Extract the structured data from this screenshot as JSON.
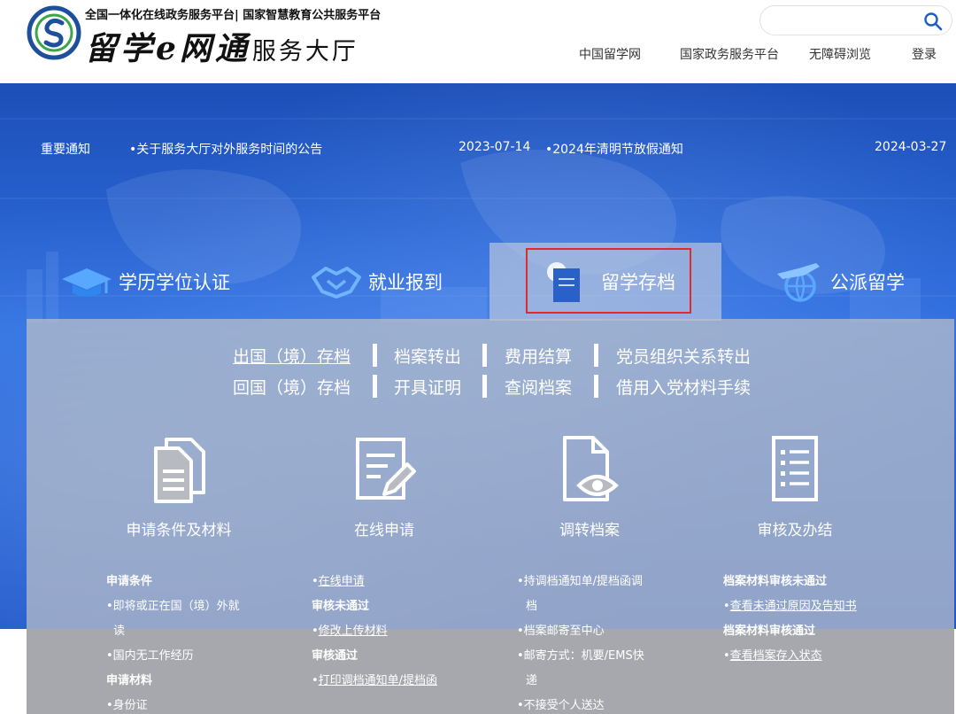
{
  "header": {
    "tagline": "全国一体化在线政务服务平台| 国家智慧教育公共服务平台",
    "title_brand": "留学e网通",
    "title_suffix": "服务大厅",
    "search_placeholder": "",
    "nav": [
      "中国留学网",
      "国家政务服务平台",
      "无障碍浏览",
      "登录"
    ]
  },
  "notices": {
    "label": "重要通知",
    "items": [
      {
        "text": "•关于服务大厅对外服务时间的公告",
        "date": "2023-07-14"
      },
      {
        "text": "•2024年清明节放假通知",
        "date": "2024-03-27"
      }
    ]
  },
  "categories": [
    {
      "label": "学历学位认证",
      "icon": "graduation-cap-icon",
      "active": false
    },
    {
      "label": "就业报到",
      "icon": "handshake-icon",
      "active": false
    },
    {
      "label": "留学存档",
      "icon": "archive-document-icon",
      "active": true
    },
    {
      "label": "公派留学",
      "icon": "plane-globe-icon",
      "active": false
    }
  ],
  "sub_links": {
    "row1": [
      "出国（境）存档",
      "档案转出",
      "费用结算",
      "党员组织关系转出"
    ],
    "row2": [
      "回国（境）存档",
      "开具证明",
      "查阅档案",
      "借用入党材料手续"
    ],
    "current": "出国（境）存档"
  },
  "steps": [
    {
      "label": "申请条件及材料",
      "icon": "documents-icon"
    },
    {
      "label": "在线申请",
      "icon": "form-edit-icon"
    },
    {
      "label": "调转档案",
      "icon": "file-view-icon"
    },
    {
      "label": "审核及办结",
      "icon": "checklist-icon"
    }
  ],
  "details": {
    "col1": {
      "h1": "申请条件",
      "i1a": "•即将或正在国（境）外就",
      "i1b": "读",
      "i2": "•国内无工作经历",
      "h2": "申请材料",
      "i3": "•身份证"
    },
    "col2": {
      "l1": "在线申请",
      "h1": "审核未通过",
      "l2": "修改上传材料",
      "h2": "审核通过",
      "l3": "打印调档通知单/提档函"
    },
    "col3": {
      "i1a": "•持调档通知单/提档函调",
      "i1b": "档",
      "i2": "•档案邮寄至中心",
      "i3a": "•邮寄方式：机要/EMS快",
      "i3b": "递",
      "i4": "•不接受个人送达"
    },
    "col4": {
      "h1": "档案材料审核未通过",
      "l1": "查看未通过原因及告知书",
      "h2": "档案材料审核通过",
      "l2": "查看档案存入状态"
    }
  },
  "colors": {
    "banner_blue": "#2f6fe0",
    "active_outline": "#e32a2a",
    "logo_blue": "#1e4f9c",
    "logo_green": "#3aa64a"
  }
}
